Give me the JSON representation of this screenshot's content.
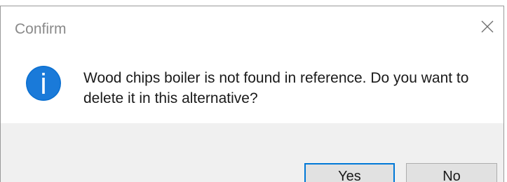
{
  "dialog": {
    "title": "Confirm",
    "message": "Wood chips boiler is not found in reference. Do you want to delete it in this alternative?",
    "icon": "info-icon",
    "buttons": {
      "yes_label": "Yes",
      "no_label": "No"
    }
  },
  "colors": {
    "icon_blue": "#0a6fd0",
    "focus_border": "#0078d7",
    "footer_bg": "#f0f0f0",
    "button_bg": "#e1e1e1"
  }
}
